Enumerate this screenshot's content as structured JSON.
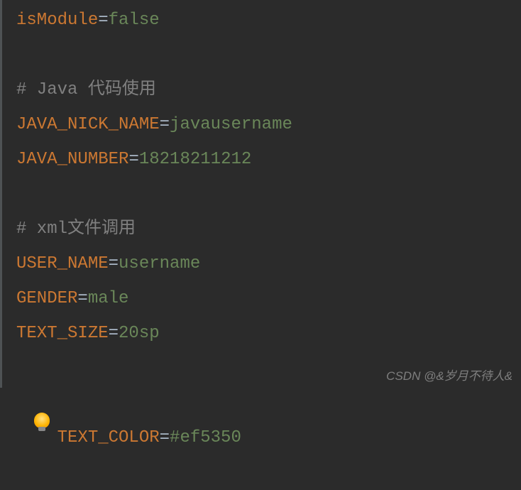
{
  "lines": {
    "l0": {
      "key": "isModule",
      "val": "false"
    },
    "c1": "# Java 代码使用",
    "l2": {
      "key": "JAVA_NICK_NAME",
      "val": "javausername"
    },
    "l3": {
      "key": "JAVA_NUMBER",
      "val": "18218211212"
    },
    "c2": "# xml文件调用",
    "l5": {
      "key": "USER_NAME",
      "val": "username"
    },
    "l6": {
      "key": "GENDER",
      "val": "male"
    },
    "l7": {
      "key": "TEXT_SIZE",
      "val": "20sp"
    },
    "l8": {
      "key": "TEXT_COLOR",
      "val": "#ef5350"
    }
  },
  "eq": "=",
  "watermark": "CSDN @&岁月不待人&"
}
